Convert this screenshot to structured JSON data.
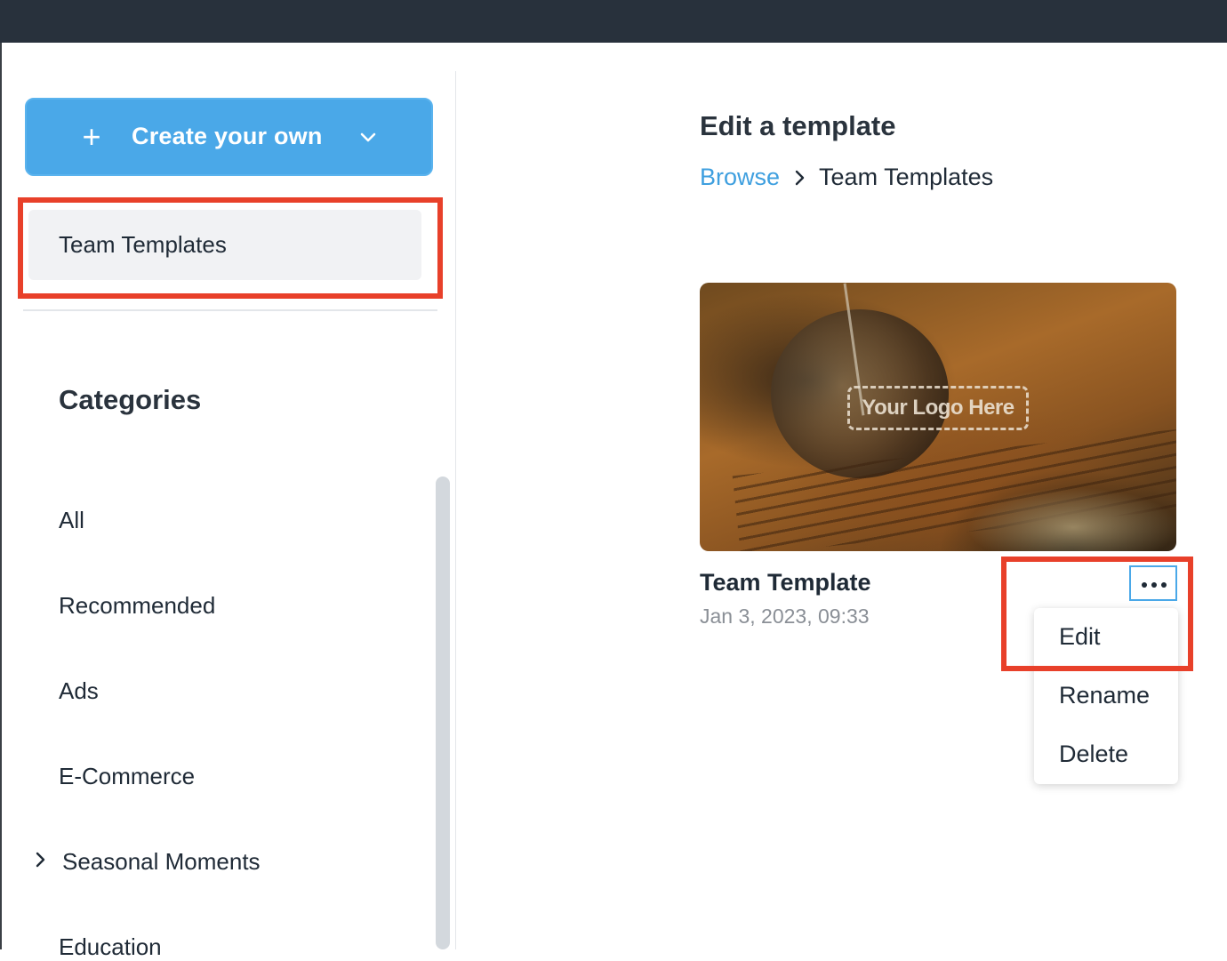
{
  "sidebar": {
    "create_button": {
      "label": "Create your own",
      "icon": "plus-icon",
      "dropdown_icon": "chevron-down-icon"
    },
    "team_templates_label": "Team Templates",
    "categories_title": "Categories",
    "categories": [
      "All",
      "Recommended",
      "Ads",
      "E-Commerce",
      "Seasonal Moments",
      "Education"
    ],
    "expandable_category_icon": "chevron-right-icon"
  },
  "main": {
    "title": "Edit a template",
    "breadcrumb": {
      "link": "Browse",
      "current": "Team Templates"
    },
    "template_card": {
      "thumbnail_logo_text": "Your Logo Here",
      "name": "Team Template",
      "date": "Jan 3, 2023, 09:33",
      "more_icon": "more-horizontal-icon"
    },
    "context_menu": [
      "Edit",
      "Rename",
      "Delete"
    ]
  },
  "colors": {
    "topbar": "#28313c",
    "accent": "#4aa8e8",
    "link": "#3e9fdf",
    "highlight": "#e8402a"
  }
}
